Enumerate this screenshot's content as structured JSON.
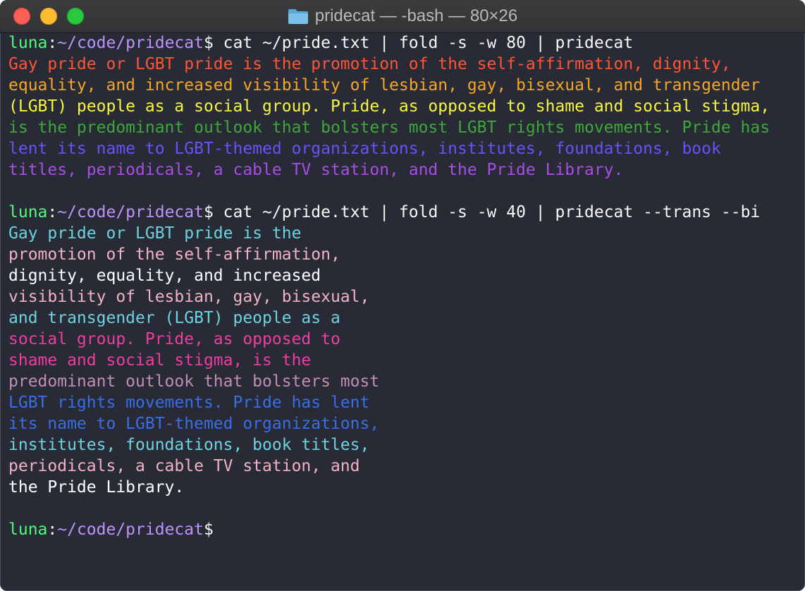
{
  "window": {
    "title": "pridecat — -bash — 80×26",
    "title_icon": "folder-icon",
    "background": "#282a36"
  },
  "prompt": {
    "user": "luna",
    "colon": ":",
    "path": "~/code/pridecat",
    "symbol": "$",
    "user_color": "#50fa7b",
    "path_color": "#bd93f9"
  },
  "commands": [
    {
      "text": " cat ~/pride.txt | fold -s -w 80 | pridecat",
      "output": [
        {
          "text": "Gay pride or LGBT pride is the promotion of the self-affirmation, dignity,",
          "color": "#ff5533"
        },
        {
          "text": "equality, and increased visibility of lesbian, gay, bisexual, and transgender",
          "color": "#f5a623"
        },
        {
          "text": "(LGBT) people as a social group. Pride, as opposed to shame and social stigma,",
          "color": "#f5f542"
        },
        {
          "text": "is the predominant outlook that bolsters most LGBT rights movements. Pride has",
          "color": "#3fa83a"
        },
        {
          "text": "lent its name to LGBT-themed organizations, institutes, foundations, book",
          "color": "#6a52f5"
        },
        {
          "text": "titles, periodicals, a cable TV station, and the Pride Library.",
          "color": "#a54fe3"
        }
      ]
    },
    {
      "text": " cat ~/pride.txt | fold -s -w 40 | pridecat --trans --bi",
      "output": [
        {
          "text": "Gay pride or LGBT pride is the",
          "color": "#6cd3e0"
        },
        {
          "text": "promotion of the self-affirmation,",
          "color": "#f2b2c3"
        },
        {
          "text": "dignity, equality, and increased",
          "color": "#ffffff"
        },
        {
          "text": "visibility of lesbian, gay, bisexual,",
          "color": "#f2b2c3"
        },
        {
          "text": "and transgender (LGBT) people as a",
          "color": "#6cd3e0"
        },
        {
          "text": "social group. Pride, as opposed to",
          "color": "#f03ca0"
        },
        {
          "text": "shame and social stigma, is the",
          "color": "#f03ca0"
        },
        {
          "text": "predominant outlook that bolsters most",
          "color": "#c08fb0"
        },
        {
          "text": "LGBT rights movements. Pride has lent",
          "color": "#3a6ee6"
        },
        {
          "text": "its name to LGBT-themed organizations,",
          "color": "#3a6ee6"
        },
        {
          "text": "institutes, foundations, book titles,",
          "color": "#6cd3e0"
        },
        {
          "text": "periodicals, a cable TV station, and",
          "color": "#f2b2c3"
        },
        {
          "text": "the Pride Library.",
          "color": "#ffffff"
        }
      ]
    }
  ],
  "final_prompt_input": ""
}
